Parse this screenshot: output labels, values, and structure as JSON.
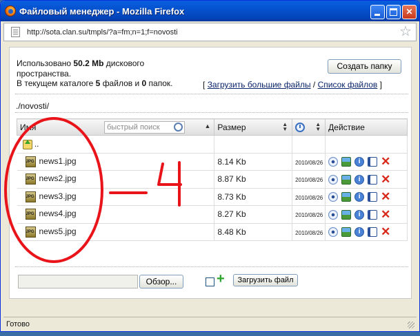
{
  "window": {
    "title": "Файловый менеджер - Mozilla Firefox",
    "url": "http://sota.clan.su/tmpls/?a=fm;n=1;f=novosti"
  },
  "info": {
    "used_prefix": "Использовано",
    "used_value": "50.2 Mb",
    "used_suffix": "дискового",
    "used_line2": "пространства.",
    "dir_prefix": "В текущем каталоге",
    "files_count": "5",
    "files_mid": "файлов и",
    "folders_count": "0",
    "folders_suffix": "папок."
  },
  "buttons": {
    "create_folder": "Создать папку",
    "browse": "Обзор...",
    "upload": "Загрузить файл"
  },
  "links": {
    "open_bracket": "[",
    "upload_large": "Загрузить большие файлы",
    "slash": "/",
    "file_list": "Список файлов",
    "close_bracket": "]"
  },
  "path": "./novosti/",
  "table": {
    "col_name": "Имя",
    "search_placeholder": "быстрый поиск",
    "col_size": "Размер",
    "col_action": "Действие",
    "parent": "..",
    "rows": [
      {
        "name": "news1.jpg",
        "size": "8.14 Kb",
        "date": "2010/08/26"
      },
      {
        "name": "news2.jpg",
        "size": "8.87 Kb",
        "date": "2010/08/26"
      },
      {
        "name": "news3.jpg",
        "size": "8.73 Kb",
        "date": "2010/08/26"
      },
      {
        "name": "news4.jpg",
        "size": "8.27 Kb",
        "date": "2010/08/26"
      },
      {
        "name": "news5.jpg",
        "size": "8.48 Kb",
        "date": "2010/08/26"
      }
    ]
  },
  "status": "Готово",
  "annotation": "–4",
  "colors": {
    "titlebar": "#0453cf",
    "annotation_red": "#e8141a",
    "delete_red": "#d8281a"
  },
  "icons": [
    "firefox-icon",
    "page-icon",
    "bookmark-star-icon",
    "search-icon",
    "clock-icon",
    "folder-up-icon",
    "jpg-file-icon",
    "view-icon",
    "image-icon",
    "info-icon",
    "properties-icon",
    "delete-icon",
    "add-icon"
  ]
}
